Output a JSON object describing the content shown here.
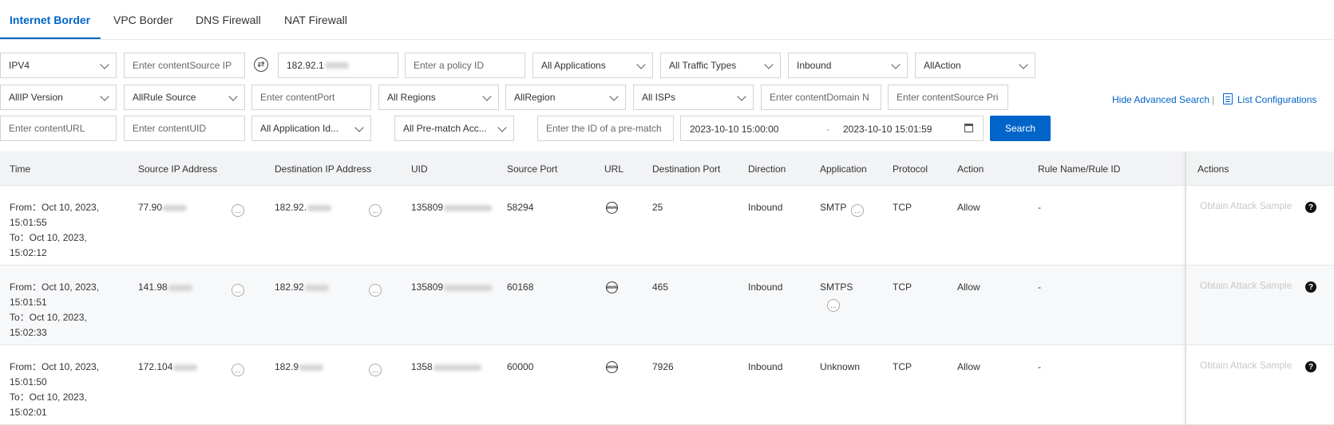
{
  "tabs": [
    {
      "label": "Internet Border",
      "active": true
    },
    {
      "label": "VPC Border",
      "active": false
    },
    {
      "label": "DNS Firewall",
      "active": false
    },
    {
      "label": "NAT Firewall",
      "active": false
    }
  ],
  "filters": {
    "row1": {
      "ip_type": "IPV4",
      "source_ip_placeholder": "Enter contentSource IP",
      "destination_ip_value": "182.92.1",
      "policy_id_placeholder": "Enter a policy ID",
      "applications": "All Applications",
      "traffic_types": "All Traffic Types",
      "direction": "Inbound",
      "action": "AllAction"
    },
    "row2": {
      "ip_version": "AllIP Version",
      "rule_source": "AllRule Source",
      "port_placeholder": "Enter contentPort",
      "regions": "All Regions",
      "region": "AllRegion",
      "isps": "All ISPs",
      "domain_placeholder": "Enter contentDomain N",
      "source_pri_placeholder": "Enter contentSource Pri"
    },
    "row3": {
      "url_placeholder": "Enter contentURL",
      "uid_placeholder": "Enter contentUID",
      "application_id": "All Application Id...",
      "prematch": "All Pre-match Acc...",
      "prematch_id_placeholder": "Enter the ID of a pre-match",
      "date_from": "2023-10-10 15:00:00",
      "date_sep": "-",
      "date_to": "2023-10-10 15:01:59"
    },
    "swap_icon": "swap-icon",
    "search_label": "Search",
    "hide_advanced_label": "Hide Advanced Search",
    "separator": "|",
    "list_config_label": "List Configurations"
  },
  "table": {
    "columns": [
      "Time",
      "Source IP Address",
      "Destination IP Address",
      "UID",
      "Source Port",
      "URL",
      "Destination Port",
      "Direction",
      "Application",
      "Protocol",
      "Action",
      "Rule Name/Rule ID",
      "Actions"
    ],
    "rows": [
      {
        "time": [
          "From：Oct 10, 2023,",
          "15:01:55",
          "To：Oct 10, 2023,",
          "15:02:12"
        ],
        "source_ip": "77.90",
        "destination_ip": "182.92.",
        "uid": "135809",
        "source_port": "58294",
        "destination_port": "25",
        "direction": "Inbound",
        "application": "SMTP",
        "protocol": "TCP",
        "action": "Allow",
        "rule": "-",
        "action_link": "Obtain Attack Sample"
      },
      {
        "time": [
          "From：Oct 10, 2023,",
          "15:01:51",
          "To：Oct 10, 2023,",
          "15:02:33"
        ],
        "source_ip": "141.98",
        "destination_ip": "182.92",
        "uid": "135809",
        "source_port": "60168",
        "destination_port": "465",
        "direction": "Inbound",
        "application": "SMTPS",
        "protocol": "TCP",
        "action": "Allow",
        "rule": "-",
        "action_link": "Obtain Attack Sample"
      },
      {
        "time": [
          "From：Oct 10, 2023,",
          "15:01:50",
          "To：Oct 10, 2023,",
          "15:02:01"
        ],
        "source_ip": "172.104",
        "destination_ip": "182.9",
        "uid": "1358",
        "source_port": "60000",
        "destination_port": "7926",
        "direction": "Inbound",
        "application": "Unknown",
        "protocol": "TCP",
        "action": "Allow",
        "rule": "-",
        "action_link": "Obtain Attack Sample"
      }
    ],
    "more_icon": "ellipsis-icon",
    "url_icon": "www-globe-icon",
    "url_icon_text": "www",
    "help_icon": "question-icon",
    "help_icon_text": "?",
    "more_icon_text": "..."
  },
  "colors": {
    "accent": "#0064c8",
    "header_bg": "#f2f3f5",
    "disabled_text": "#c8c8c8"
  }
}
